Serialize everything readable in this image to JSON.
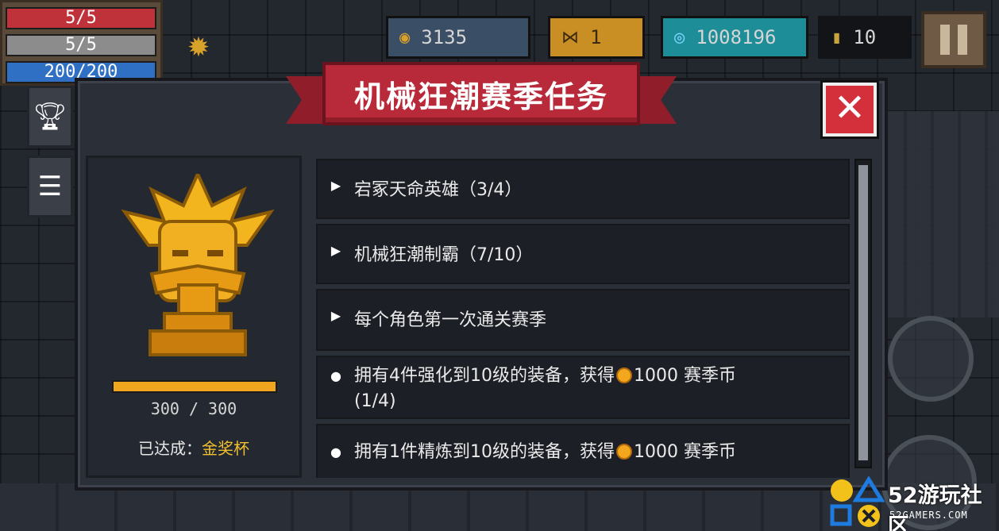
{
  "hud": {
    "hp": "5/5",
    "armor": "5/5",
    "energy": "200/200",
    "coins": "3135",
    "fish": "1",
    "gems": "1008196",
    "seeds": "10",
    "coins_icon": "coin-icon",
    "fish_icon": "fish-icon",
    "gems_icon": "gem-icon",
    "seeds_icon": "seed-icon"
  },
  "tabs": {
    "trophy_icon": "trophy-icon",
    "list_icon": "list-icon"
  },
  "panel": {
    "title": "机械狂潮赛季任务",
    "close_icon": "close-icon"
  },
  "trophy": {
    "progress_text": "300 / 300",
    "progress_fraction": 1.0,
    "achieved_label": "已达成：",
    "achieved_value": "金奖杯"
  },
  "quests": [
    {
      "type": "expandable",
      "text": "宕冢天命英雄（3/4）"
    },
    {
      "type": "expandable",
      "text": "机械狂潮制霸（7/10）"
    },
    {
      "type": "expandable",
      "text": "每个角色第一次通关赛季"
    },
    {
      "type": "bullet",
      "text_before": "拥有4件强化到10级的装备，获得",
      "reward": "1000 赛季币",
      "text_after": "(1/4)"
    },
    {
      "type": "bullet",
      "text_before": "拥有1件精炼到10级的装备，获得",
      "reward": "1000 赛季币",
      "text_after": ""
    }
  ],
  "watermark": {
    "brand": "52游玩社区",
    "site": "52GAMERS.COM"
  },
  "colors": {
    "ribbon": "#b8293a",
    "close": "#d4303c",
    "gold": "#f2c02f",
    "progress": "#f0a51f"
  }
}
